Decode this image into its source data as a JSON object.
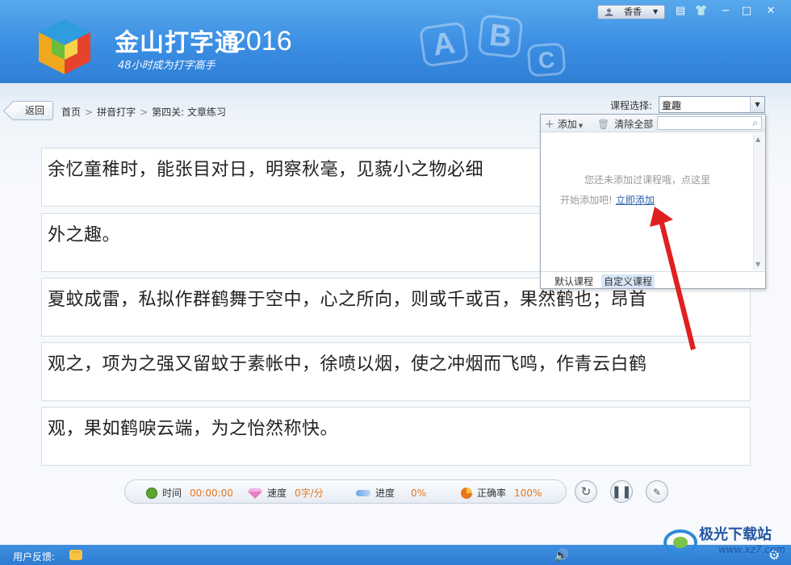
{
  "app": {
    "title": "金山打字通",
    "year": "2016",
    "slogan": "48小时成为打字高手",
    "bg_letters": [
      "A",
      "B",
      "C"
    ]
  },
  "window": {
    "user_name": "香香",
    "controls": [
      "skin-icon",
      "shirt-icon",
      "minimize-icon",
      "maximize-icon",
      "close-icon"
    ]
  },
  "nav": {
    "back_label": "返回",
    "breadcrumbs": [
      "首页",
      "拼音打字",
      "第四关: 文章练习"
    ],
    "separator": ">"
  },
  "course": {
    "label": "课程选择:",
    "selected": "童趣"
  },
  "lines": [
    "余忆童稚时，能张目对日，明察秋毫，见藐小之物必细",
    "外之趣。",
    "夏蚊成雷，私拟作群鹤舞于空中，心之所向，则或千或百，果然鹤也；昂首",
    "观之，项为之强又留蚊于素帐中，徐喷以烟，使之冲烟而飞鸣，作青云白鹤",
    "观，果如鹤唳云端，为之怡然称快。"
  ],
  "panel": {
    "add_label": "添加",
    "clear_label": "清除全部",
    "search_value": "",
    "message_line1": "您还未添加过课程哦，点这里",
    "message_line2": "开始添加吧!",
    "link_label": "立即添加",
    "tabs": [
      "默认课程",
      "自定义课程"
    ],
    "active_tab": "自定义课程"
  },
  "stats": {
    "time_label": "时间",
    "time_value": "00:00:00",
    "speed_label": "速度",
    "speed_value": "0字/分",
    "progress_label": "进度",
    "progress_value": "0%",
    "accuracy_label": "正确率",
    "accuracy_value": "100%"
  },
  "statusbar": {
    "feedback_label": "用户反馈:"
  },
  "watermark": {
    "text": "极光下载站",
    "url": "www.xz7.com"
  },
  "colors": {
    "header_blue": "#3b8ee3",
    "accent_orange": "#e8741c",
    "annotation_red": "#e02020",
    "link_blue": "#2a5ea8"
  }
}
